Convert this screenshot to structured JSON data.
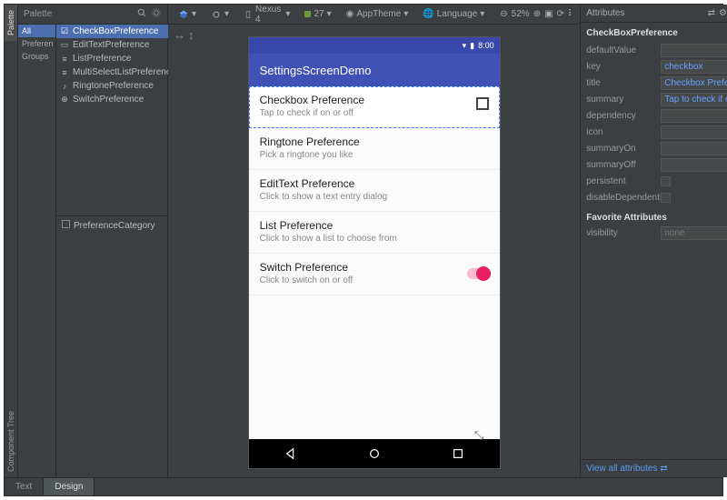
{
  "side_tabs": {
    "palette": "Palette",
    "tree": "Component Tree"
  },
  "palette": {
    "title": "Palette",
    "groups": [
      "All",
      "Preferen",
      "Groups"
    ],
    "items": [
      {
        "label": "CheckBoxPreference",
        "icon": "checkbox",
        "selected": true
      },
      {
        "label": "EditTextPreference",
        "icon": "edit"
      },
      {
        "label": "ListPreference",
        "icon": "list"
      },
      {
        "label": "MultiSelectListPreference",
        "icon": "list"
      },
      {
        "label": "RingtonePreference",
        "icon": "ringtone"
      },
      {
        "label": "SwitchPreference",
        "icon": "switch"
      }
    ],
    "category": "PreferenceCategory"
  },
  "toolbar": {
    "device": "Nexus 4",
    "api": "27",
    "theme": "AppTheme",
    "language": "Language",
    "zoom": "52%"
  },
  "phone": {
    "time": "8:00",
    "app_title": "SettingsScreenDemo",
    "prefs": [
      {
        "title": "Checkbox Preference",
        "summary": "Tap to check if on or off",
        "widget": "checkbox",
        "selected": true
      },
      {
        "title": "Ringtone Preference",
        "summary": "Pick a ringtone you like"
      },
      {
        "title": "EditText Preference",
        "summary": "Click to show a text entry dialog"
      },
      {
        "title": "List Preference",
        "summary": "Click to show a list to choose from"
      },
      {
        "title": "Switch Preference",
        "summary": "Click to switch on or off",
        "widget": "switch"
      }
    ]
  },
  "attributes": {
    "panel_title": "Attributes",
    "component": "CheckBoxPreference",
    "rows": [
      {
        "k": "defaultValue",
        "v": ""
      },
      {
        "k": "key",
        "v": "checkbox"
      },
      {
        "k": "title",
        "v": "Checkbox Preference"
      },
      {
        "k": "summary",
        "v": "Tap to check if on or off"
      },
      {
        "k": "dependency",
        "v": ""
      },
      {
        "k": "icon",
        "v": ""
      },
      {
        "k": "summaryOn",
        "v": ""
      },
      {
        "k": "summaryOff",
        "v": ""
      }
    ],
    "bools": [
      {
        "k": "persistent"
      },
      {
        "k": "disableDependents"
      }
    ],
    "favorite_header": "Favorite Attributes",
    "visibility": {
      "k": "visibility",
      "v": "none"
    },
    "link": "View all attributes"
  },
  "bottom_tabs": {
    "text": "Text",
    "design": "Design"
  }
}
